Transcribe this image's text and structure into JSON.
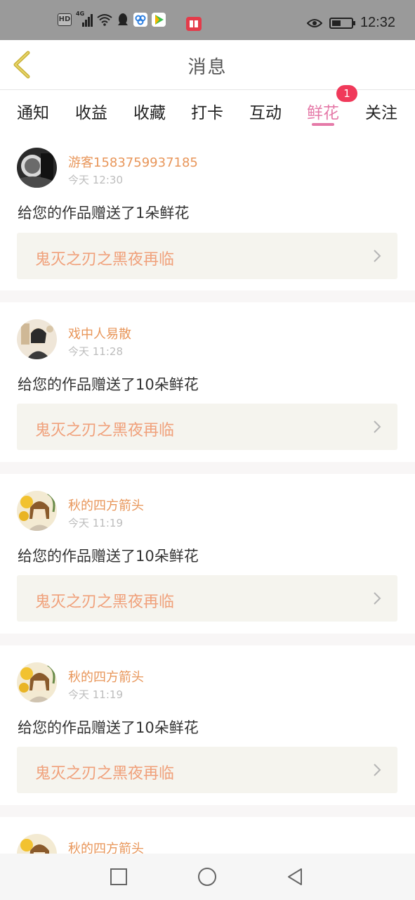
{
  "status_bar": {
    "hd_label": "HD",
    "network_label": "4G",
    "time": "12:32",
    "icons": [
      "hd-icon",
      "signal-icon",
      "wifi-icon",
      "qq-icon",
      "app-icon",
      "video-app-icon",
      "reader-app-icon",
      "eye-icon",
      "battery-icon"
    ]
  },
  "header": {
    "title": "消息",
    "back_icon": "chevron-left-icon"
  },
  "tabs": [
    {
      "label": "通知",
      "active": false
    },
    {
      "label": "收益",
      "active": false
    },
    {
      "label": "收藏",
      "active": false
    },
    {
      "label": "打卡",
      "active": false
    },
    {
      "label": "互动",
      "active": false
    },
    {
      "label": "鲜花",
      "active": true,
      "badge": "1"
    },
    {
      "label": "关注",
      "active": false
    }
  ],
  "colors": {
    "accent_pink": "#e57aa8",
    "username_orange": "#e8965a",
    "work_title": "#f0a07a",
    "badge_red": "#f0395a",
    "card_bg": "#f5f4ee"
  },
  "messages": [
    {
      "user": "游客1583759937185",
      "time": "今天 12:30",
      "text": "给您的作品赠送了1朵鲜花",
      "work": "鬼灭之刃之黑夜再临"
    },
    {
      "user": "戏中人易散",
      "time": "今天 11:28",
      "text": "给您的作品赠送了10朵鲜花",
      "work": "鬼灭之刃之黑夜再临"
    },
    {
      "user": "秋的四方箭头",
      "time": "今天 11:19",
      "text": "给您的作品赠送了10朵鲜花",
      "work": "鬼灭之刃之黑夜再临"
    },
    {
      "user": "秋的四方箭头",
      "time": "今天 11:19",
      "text": "给您的作品赠送了10朵鲜花",
      "work": "鬼灭之刃之黑夜再临"
    },
    {
      "user": "秋的四方箭头"
    }
  ],
  "nav": {
    "icons": [
      "recent-apps-icon",
      "home-icon",
      "back-icon"
    ]
  }
}
